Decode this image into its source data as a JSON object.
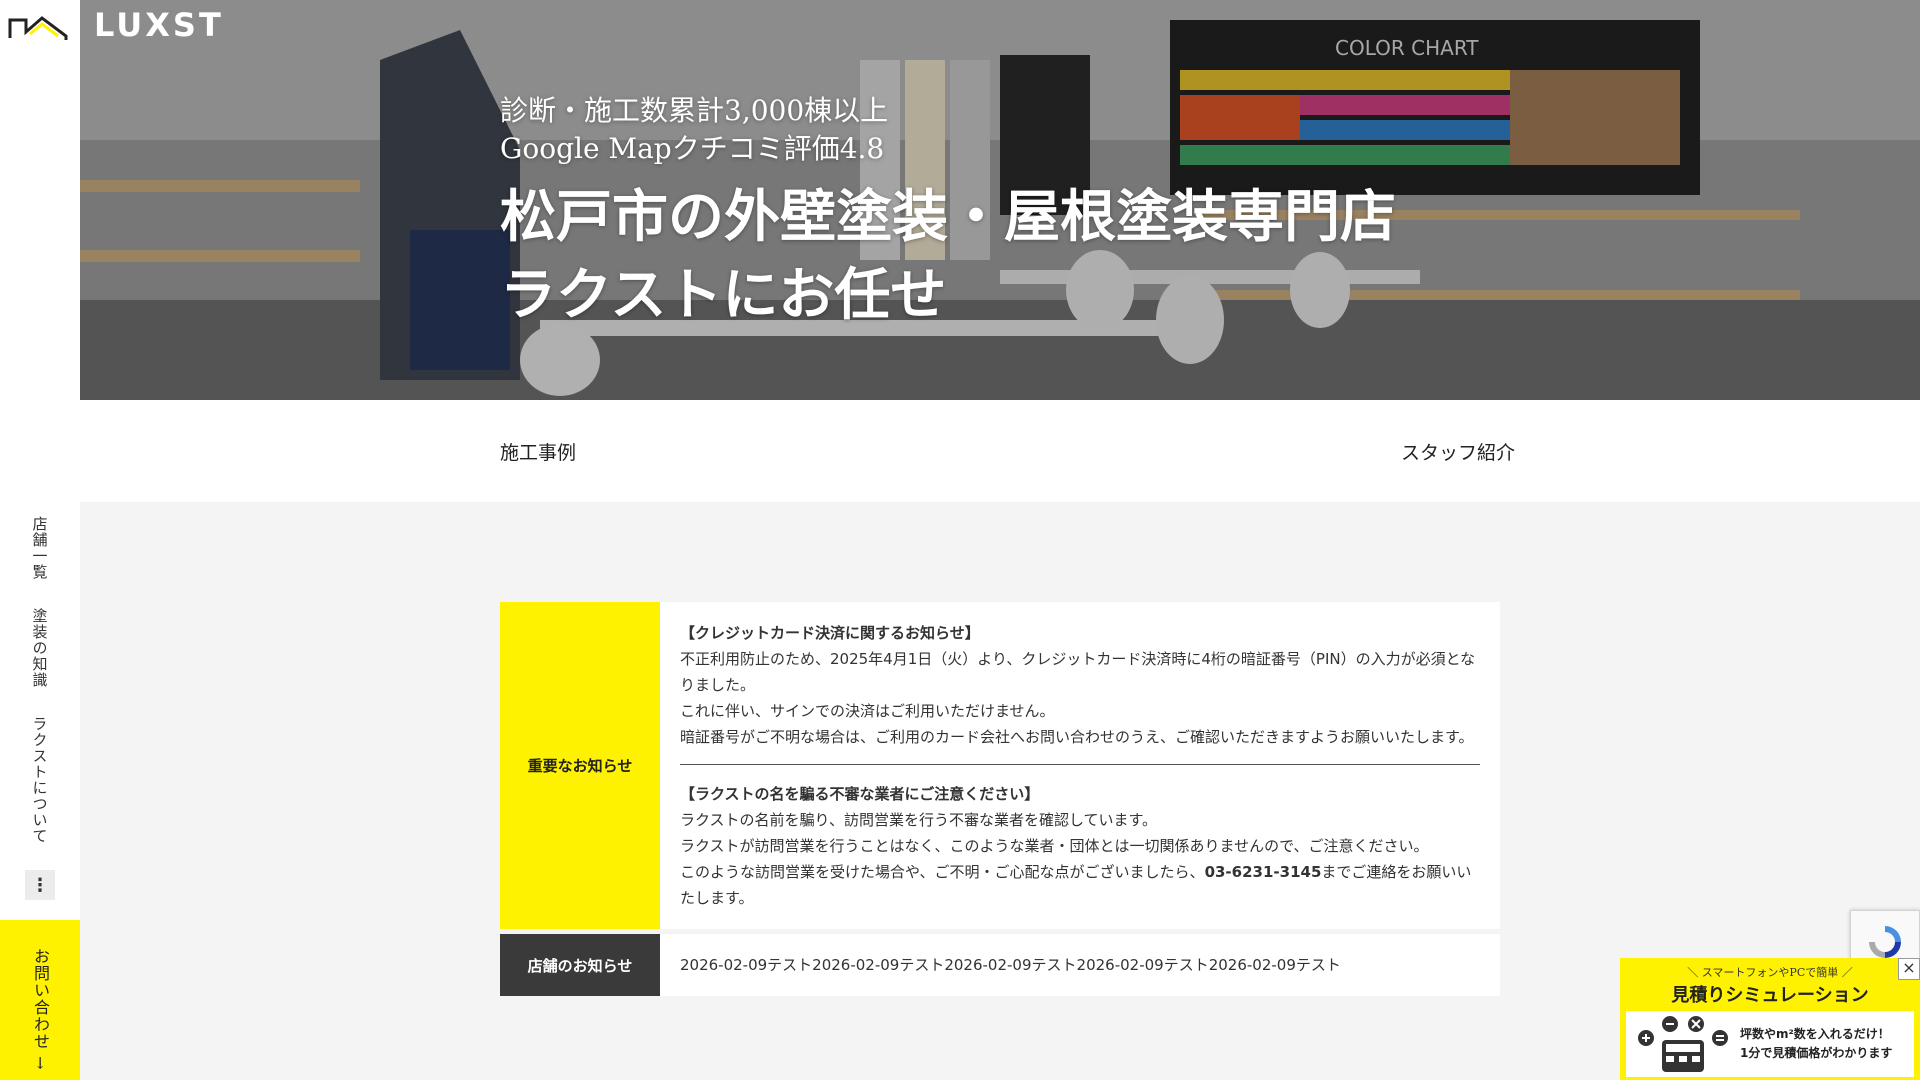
{
  "header": {
    "brand": "LUXST"
  },
  "sidebar": {
    "items": [
      {
        "label": "店舗一覧"
      },
      {
        "label": "塗装の知識"
      },
      {
        "label": "ラクストについて"
      }
    ],
    "more_label": "⋮",
    "contact_label": "お問い合わせ →"
  },
  "hero": {
    "sub_line1": "診断・施工数累計3,000棟以上",
    "sub_line2": "Google Mapクチコミ評価4.8",
    "title_line1": "松戸市の外壁塗装・屋根塗装専門店",
    "title_line2": "ラクストにお任せ",
    "color_chart_label": "COLOR CHART"
  },
  "tabs": {
    "left": "施工事例",
    "right": "スタッフ紹介"
  },
  "notices": {
    "important_label": "重要なお知らせ",
    "credit": {
      "heading": "【クレジットカード決済に関するお知らせ】",
      "line1": "不正利用防止のため、2025年4月1日（火）より、クレジットカード決済時に4桁の暗証番号（PIN）の入力が必須となりました。",
      "line2": "これに伴い、サインでの決済はご利用いただけません。",
      "line3": "暗証番号がご不明な場合は、ご利用のカード会社へお問い合わせのうえ、ご確認いただきますようお願いいたします。"
    },
    "fraud": {
      "heading": "【ラクストの名を騙る不審な業者にご注意ください】",
      "line1": "ラクストの名前を騙り、訪問営業を行う不審な業者を確認しています。",
      "line2": "ラクストが訪問営業を行うことはなく、このような業者・団体とは一切関係ありませんので、ご注意ください。",
      "line3_pre": "このような訪問営業を受けた場合や、ご不明・ご心配な点がございましたら、",
      "phone": "03-6231-3145",
      "line3_post": "までご連絡をお願いいたします。"
    },
    "store_label": "店舗のお知らせ",
    "store_text": "2026-02-09テスト2026-02-09テスト2026-02-09テスト2026-02-09テスト2026-02-09テスト"
  },
  "sim_banner": {
    "top": "＼ スマートフォンやPCで簡単 ／",
    "title": "見積りシミュレーション",
    "text1": "坪数やm²数を入れるだけ！",
    "text2": "1分で見積価格がわかります",
    "close": "×"
  },
  "colors": {
    "accent_yellow": "#fff200",
    "dark_label": "#3a3a3a"
  }
}
